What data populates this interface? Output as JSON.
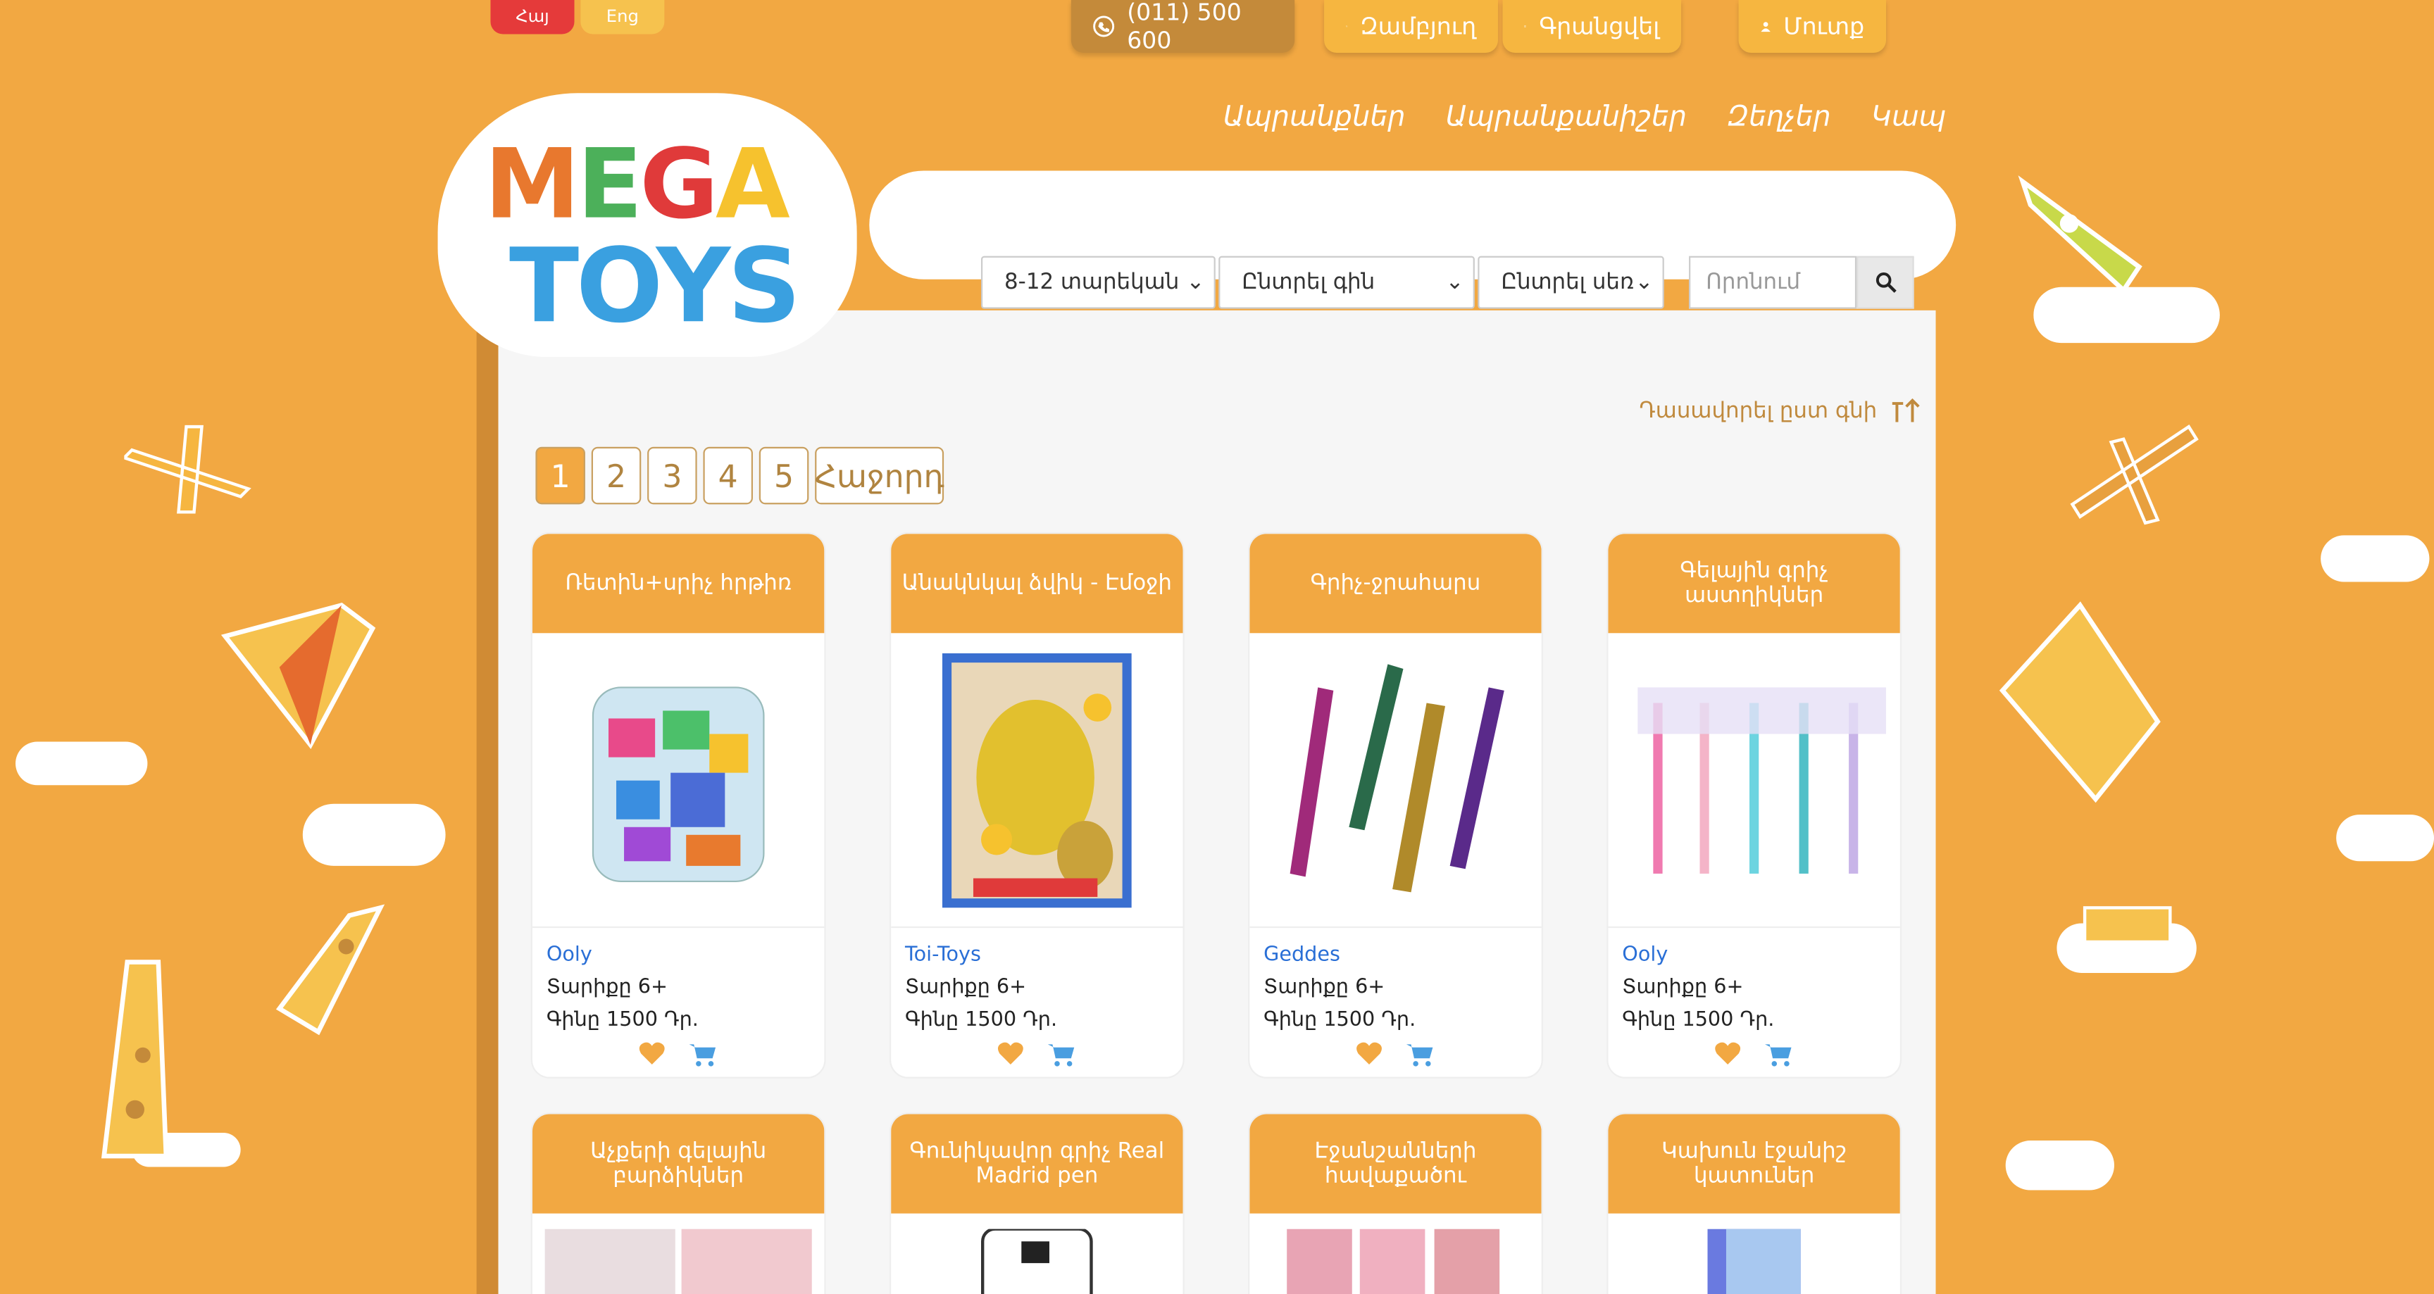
{
  "lang": {
    "hy": "Հայ",
    "en": "Eng"
  },
  "topbar": {
    "phone": "(011) 500 600",
    "cart": "Զամբյուղ",
    "register": "Գրանցվել",
    "login": "Մուտք"
  },
  "nav": [
    "Ապրանքներ",
    "Ապրանքանիշեր",
    "Զեղչեր",
    "Կապ"
  ],
  "logo": {
    "line1": "MEGA",
    "line2": "TOYS"
  },
  "filters": {
    "age": "8-12 տարեկան",
    "price": "Ընտրել գին",
    "gender": "Ընտրել սեռ"
  },
  "search": {
    "placeholder": "Որոնում"
  },
  "sort": {
    "label": "Դասավորել ըստ գնի"
  },
  "pagination": {
    "pages": [
      "1",
      "2",
      "3",
      "4",
      "5"
    ],
    "next": "Հաջորդ",
    "current": "1"
  },
  "products": [
    {
      "title": "Ռետին+սրիչ հրթիռ",
      "brand": "Ooly",
      "age": "Տարիքը 6+",
      "price": "Գինը 1500 Դր."
    },
    {
      "title": "Անակնկալ ձվիկ - Էմօջի",
      "brand": "Toi-Toys",
      "age": "Տարիքը 6+",
      "price": "Գինը 1500 Դր."
    },
    {
      "title": "Գրիչ-ջրահարս",
      "brand": "Geddes",
      "age": "Տարիքը 6+",
      "price": "Գինը 1500 Դր."
    },
    {
      "title": "Գելային գրիչ աստղիկներ",
      "brand": "Ooly",
      "age": "Տարիքը 6+",
      "price": "Գինը 1500 Դր."
    },
    {
      "title": "Աչքերի գելային բարձիկներ"
    },
    {
      "title": "Գունիկավոր գրիչ Real Madrid pen"
    },
    {
      "title": "Էջանշանների հավաքածու"
    },
    {
      "title": "Կախուն էջանիշ կատուներ"
    }
  ],
  "colors": {
    "background": "#f2a842",
    "accent": "#f2a842",
    "brand_link": "#2a6fd6",
    "lang_active": "#e53a3a"
  }
}
